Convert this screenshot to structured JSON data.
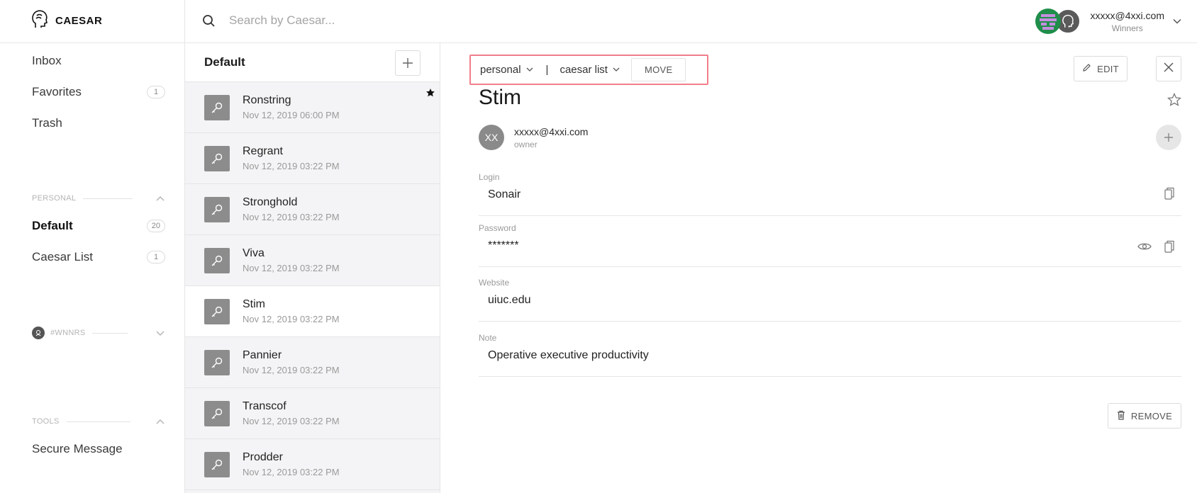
{
  "app": {
    "brand": "CAESAR"
  },
  "search": {
    "placeholder": "Search by Caesar..."
  },
  "user": {
    "email": "xxxxx@4xxi.com",
    "team": "Winners"
  },
  "sidebar": {
    "main_items": [
      {
        "label": "Inbox",
        "badge": ""
      },
      {
        "label": "Favorites",
        "badge": "1"
      },
      {
        "label": "Trash",
        "badge": ""
      }
    ],
    "personal_section": "PERSONAL",
    "personal_items": [
      {
        "label": "Default",
        "badge": "20"
      },
      {
        "label": "Caesar List",
        "badge": "1"
      }
    ],
    "team_section": "#WNNRS",
    "tools_section": "TOOLS",
    "tools_items": [
      {
        "label": "Secure Message"
      }
    ]
  },
  "list": {
    "title": "Default",
    "items": [
      {
        "name": "Ronstring",
        "date": "Nov 12, 2019 06:00 PM",
        "starred": true
      },
      {
        "name": "Regrant",
        "date": "Nov 12, 2019 03:22 PM"
      },
      {
        "name": "Stronghold",
        "date": "Nov 12, 2019 03:22 PM"
      },
      {
        "name": "Viva",
        "date": "Nov 12, 2019 03:22 PM"
      },
      {
        "name": "Stim",
        "date": "Nov 12, 2019 03:22 PM",
        "selected": true
      },
      {
        "name": "Pannier",
        "date": "Nov 12, 2019 03:22 PM"
      },
      {
        "name": "Transcof",
        "date": "Nov 12, 2019 03:22 PM"
      },
      {
        "name": "Prodder",
        "date": "Nov 12, 2019 03:22 PM"
      }
    ]
  },
  "detail": {
    "breadcrumb": {
      "team": "personal",
      "separator": "|",
      "list": "caesar list",
      "move_label": "MOVE"
    },
    "edit_label": "EDIT",
    "title": "Stim",
    "owner": {
      "initials": "XX",
      "email": "xxxxx@4xxi.com",
      "role": "owner"
    },
    "fields": {
      "login": {
        "label": "Login",
        "value": "Sonair"
      },
      "password": {
        "label": "Password",
        "value": "*******"
      },
      "website": {
        "label": "Website",
        "value": "uiuc.edu"
      },
      "note": {
        "label": "Note",
        "value": "Operative executive productivity"
      }
    },
    "remove_label": "REMOVE"
  },
  "colors": {
    "highlight_border": "#f07f8a",
    "icon_bg": "#8c8c8c",
    "list_bg": "#f4f4f6"
  }
}
